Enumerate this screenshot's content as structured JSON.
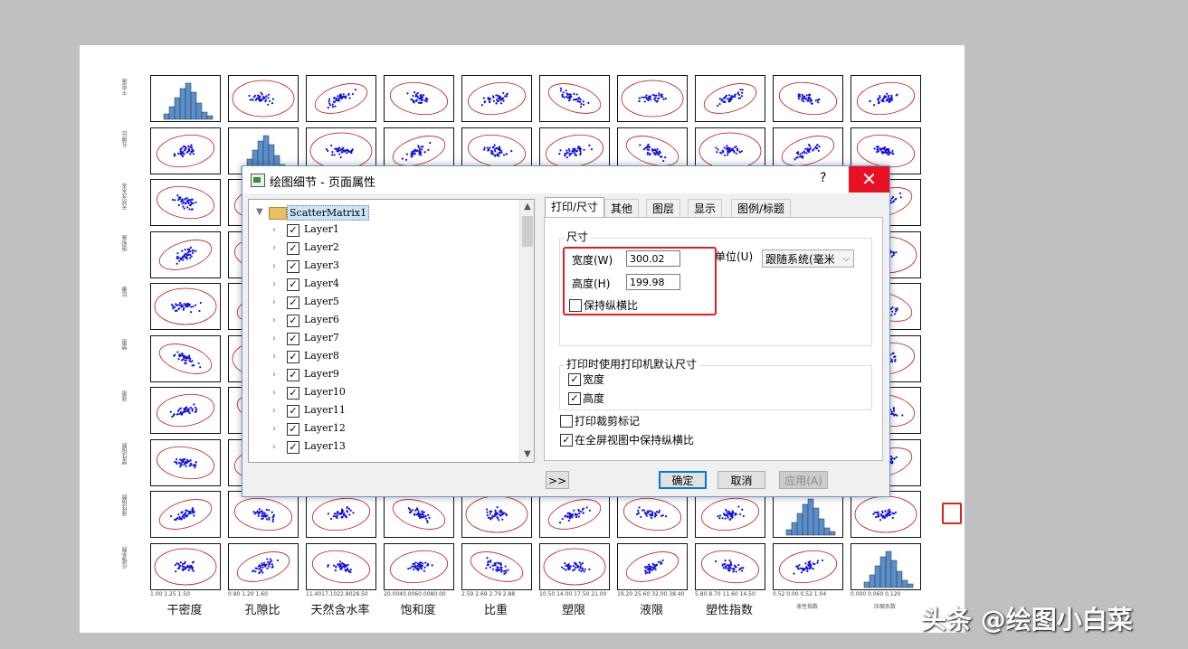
{
  "matrix": {
    "row_labels": [
      "干密度",
      "孔隙比",
      "天然含水率",
      "饱和度",
      "比重",
      "塑限",
      "液限",
      "塑性指数",
      "液性指数",
      "压缩系数"
    ],
    "col_labels": [
      "干密度",
      "孔隙比",
      "天然含水率",
      "饱和度",
      "比重",
      "塑限",
      "液限",
      "塑性指数",
      "液性指数",
      "压缩系数"
    ],
    "x_tick_labels": [
      "1.00  1.25  1.50",
      "0.80  1.20  1.60",
      "11.4017.1022.8028.50",
      "20.0040.0060.0080.00",
      "2.59  2.69  2.79  2.88",
      "10.50 14.00 17.50 21.00",
      "19.20 25.60 32.00 38.40",
      "5.80  8.70 11.60 14.50",
      "0.52  0.00  0.52  1.04",
      "0.000  0.060  0.120"
    ]
  },
  "dialog": {
    "title": "绘图细节 - 页面属性",
    "help": "?",
    "close": "✕",
    "tree_root": "ScatterMatrix1",
    "layers": [
      "Layer1",
      "Layer2",
      "Layer3",
      "Layer4",
      "Layer5",
      "Layer6",
      "Layer7",
      "Layer8",
      "Layer9",
      "Layer10",
      "Layer11",
      "Layer12",
      "Layer13"
    ],
    "tabs": [
      "打印/尺寸",
      "其他",
      "图层",
      "显示",
      "图例/标题"
    ],
    "size_group": "尺寸",
    "width_label": "宽度(W)",
    "width_value": "300.02",
    "height_label": "高度(H)",
    "height_value": "199.98",
    "keep_ratio": "保持纵横比",
    "unit_label": "单位(U)",
    "unit_value": "跟随系统(毫米",
    "printer_group": "打印时使用打印机默认尺寸",
    "printer_width": "宽度",
    "printer_height": "高度",
    "crop_marks": "打印裁剪标记",
    "fullscreen_ratio": "在全屏视图中保持纵横比",
    "expand_btn": ">>",
    "ok": "确定",
    "cancel": "取消",
    "apply": "应用(A)"
  },
  "watermark": "头条 @绘图小白菜"
}
